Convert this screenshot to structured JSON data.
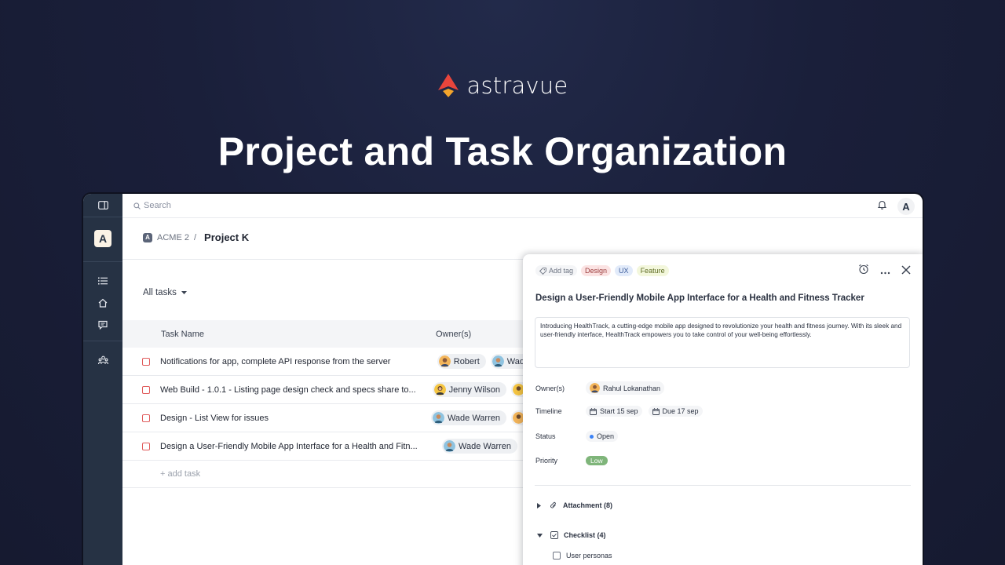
{
  "brand": {
    "name": "astravue"
  },
  "hero": {
    "title": "Project and Task Organization"
  },
  "topbar": {
    "search_placeholder": "Search",
    "user_initial": "A"
  },
  "sidebar": {
    "workspace_initial": "A",
    "icons": [
      "list-icon",
      "home-icon",
      "chat-icon",
      "team-icon"
    ]
  },
  "breadcrumb": {
    "workspace_badge": "A",
    "workspace": "ACME 2",
    "separator": "/",
    "project": "Project K"
  },
  "filter": {
    "label": "All tasks"
  },
  "table": {
    "columns": {
      "name": "Task Name",
      "owners": "Owner(s)"
    },
    "rows": [
      {
        "name": "Notifications for app, complete API response from the server",
        "owners": [
          "Robert",
          "Wad"
        ]
      },
      {
        "name": "Web Build - 1.0.1 - Listing page design check and specs share to...",
        "owners": [
          "Jenny Wilson",
          ""
        ]
      },
      {
        "name": "Design - List View for issues",
        "owners": [
          "Wade Warren",
          ""
        ]
      },
      {
        "name": "Design a User-Friendly Mobile App Interface for a Health and Fitn...",
        "owners": [
          "Wade Warren"
        ]
      }
    ],
    "add_task": "+ add task"
  },
  "panel": {
    "add_tag": "Add tag",
    "tags": [
      {
        "label": "Design",
        "bg": "#fbe3e3",
        "fg": "#9a3b3b"
      },
      {
        "label": "UX",
        "bg": "#e2ebfa",
        "fg": "#3b5b9a"
      },
      {
        "label": "Feature",
        "bg": "#f3f7dc",
        "fg": "#5d6b22"
      }
    ],
    "title": "Design a User-Friendly Mobile App Interface for a Health and Fitness Tracker",
    "description": "Introducing HealthTrack, a cutting-edge mobile app designed to revolutionize your health and fitness journey. With its sleek and user-friendly interface, HealthTrack empowers you to take control of your well-being effortlessly.",
    "fields": {
      "owners_label": "Owner(s)",
      "owner": "Rahul Lokanathan",
      "timeline_label": "Timeline",
      "start": "Start 15 sep",
      "due": "Due 17 sep",
      "status_label": "Status",
      "status": "Open",
      "priority_label": "Priority",
      "priority": "Low"
    },
    "sections": {
      "attachment": "Attachment (8)",
      "checklist": "Checklist (4)",
      "checklist_item": "User personas"
    }
  },
  "colors": {
    "brand_red": "#e8453c",
    "brand_amber": "#f4a52c",
    "sidebar": "#263244",
    "status_dot": "#3b82f6",
    "priority_low": "#7fb57a"
  }
}
